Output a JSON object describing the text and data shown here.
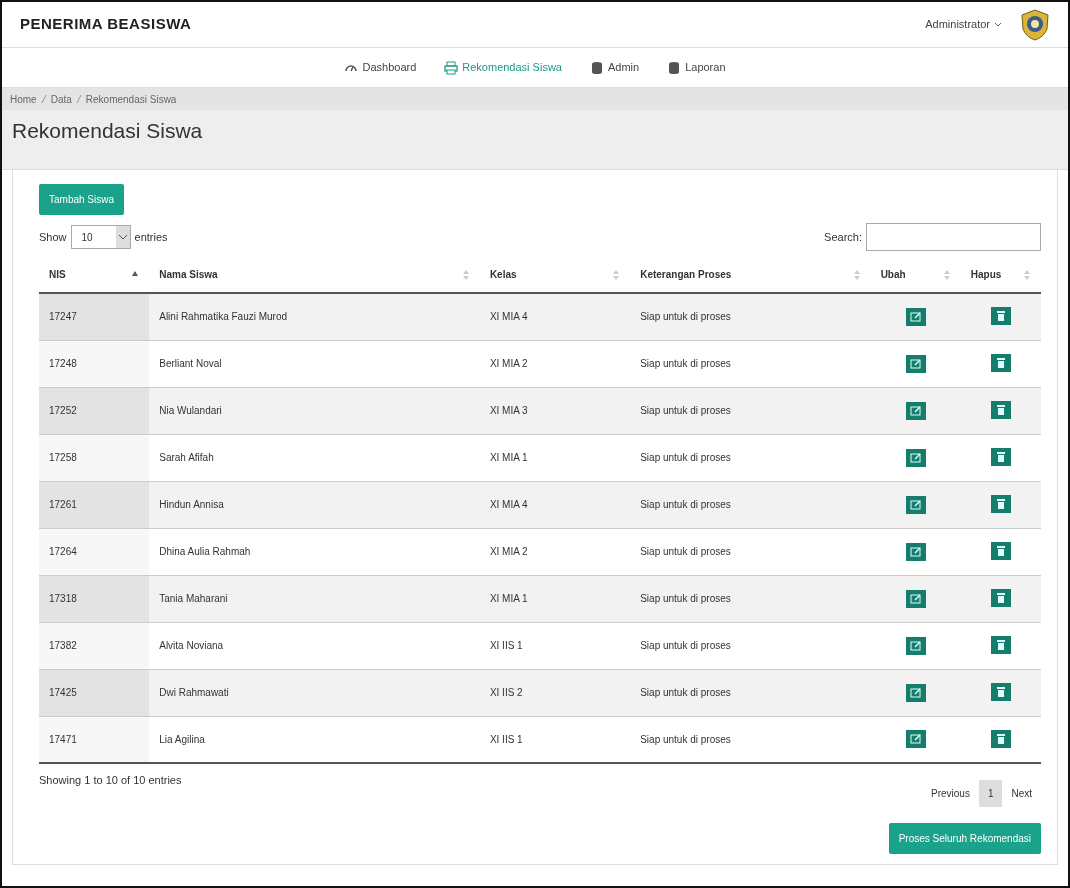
{
  "brand": "PENERIMA BEASISWA",
  "user_menu": {
    "label": "Administrator"
  },
  "nav": [
    {
      "label": "Dashboard",
      "selected": false
    },
    {
      "label": "Rekomendasi Siswa",
      "selected": true
    },
    {
      "label": "Admin",
      "selected": false
    },
    {
      "label": "Laporan",
      "selected": false
    }
  ],
  "breadcrumb": [
    "Home",
    "Data",
    "Rekomendasi Siswa"
  ],
  "page_title": "Rekomendasi Siswa",
  "add_button": "Tambah Siswa",
  "length": {
    "show": "Show",
    "value": "10",
    "entries": "entries"
  },
  "search": {
    "label": "Search:"
  },
  "table": {
    "columns": [
      {
        "label": "NIS",
        "sorted": true
      },
      {
        "label": "Nama Siswa",
        "sorted": false
      },
      {
        "label": "Kelas",
        "sorted": false
      },
      {
        "label": "Keterangan Proses",
        "sorted": false
      },
      {
        "label": "Ubah",
        "sorted": false
      },
      {
        "label": "Hapus",
        "sorted": false
      }
    ],
    "rows": [
      {
        "nis": "17247",
        "nama": "Alini Rahmatika Fauzi Murod",
        "kelas": "XI MIA 4",
        "keterangan": "Siap untuk di proses"
      },
      {
        "nis": "17248",
        "nama": "Berliant Noval",
        "kelas": "XI MIA 2",
        "keterangan": "Siap untuk di proses"
      },
      {
        "nis": "17252",
        "nama": "Nia Wulandari",
        "kelas": "XI MIA 3",
        "keterangan": "Siap untuk di proses"
      },
      {
        "nis": "17258",
        "nama": "Sarah Afifah",
        "kelas": "XI MIA 1",
        "keterangan": "Siap untuk di proses"
      },
      {
        "nis": "17261",
        "nama": "Hindun Annisa",
        "kelas": "XI MIA 4",
        "keterangan": "Siap untuk di proses"
      },
      {
        "nis": "17264",
        "nama": "Dhina Aulia Rahmah",
        "kelas": "XI MIA 2",
        "keterangan": "Siap untuk di proses"
      },
      {
        "nis": "17318",
        "nama": "Tania Maharani",
        "kelas": "XI MIA 1",
        "keterangan": "Siap untuk di proses"
      },
      {
        "nis": "17382",
        "nama": "Alvita Noviana",
        "kelas": "XI IIS 1",
        "keterangan": "Siap untuk di proses"
      },
      {
        "nis": "17425",
        "nama": "Dwi Rahmawati",
        "kelas": "XI IIS 2",
        "keterangan": "Siap untuk di proses"
      },
      {
        "nis": "17471",
        "nama": "Lia Agilina",
        "kelas": "XI IIS 1",
        "keterangan": "Siap untuk di proses"
      }
    ]
  },
  "info": "Showing 1 to 10 of 10 entries",
  "pagination": [
    {
      "label": "Previous",
      "selected": false
    },
    {
      "label": "1",
      "selected": true
    },
    {
      "label": "Next",
      "selected": false
    }
  ],
  "process_button": "Proses Seluruh Rekomendasi"
}
